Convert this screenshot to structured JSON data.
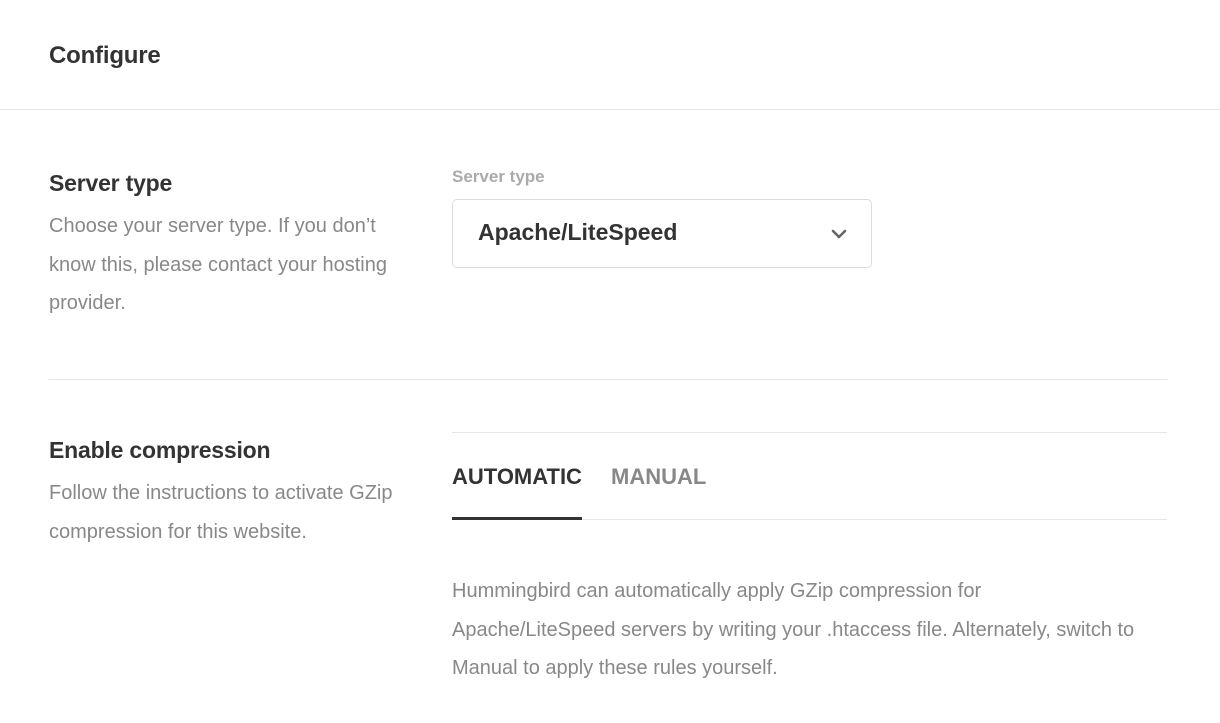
{
  "header": {
    "title": "Configure"
  },
  "server_section": {
    "title": "Server type",
    "description": "Choose your server type. If you don’t know this, please contact your hosting provider.",
    "field_label": "Server type",
    "selected_value": "Apache/LiteSpeed"
  },
  "compression_section": {
    "title": "Enable compression",
    "description": "Follow the instructions to activate GZip compression for this website.",
    "tabs": [
      {
        "label": "AUTOMATIC",
        "active": true
      },
      {
        "label": "MANUAL",
        "active": false
      }
    ],
    "content": "Hummingbird can automatically apply GZip compression for Apache/LiteSpeed servers by writing your .htaccess file. Alternately, switch to Manual to apply these rules yourself."
  },
  "icons": {
    "select_chevron": "chevron-down-icon"
  },
  "colors": {
    "text_primary": "#333333",
    "text_secondary": "#888888",
    "label_muted": "#aaaaaa",
    "border": "#e6e6e6"
  }
}
